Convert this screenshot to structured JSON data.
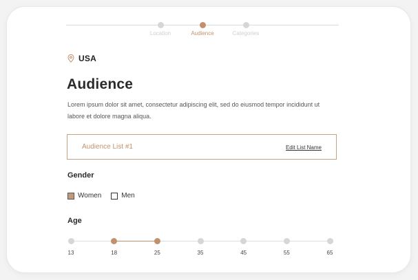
{
  "stepper": {
    "steps": [
      {
        "label": "Location",
        "active": false
      },
      {
        "label": "Audience",
        "active": true
      },
      {
        "label": "Categories",
        "active": false
      }
    ]
  },
  "location": {
    "icon": "map-pin-icon",
    "label": "USA"
  },
  "page": {
    "title": "Audience",
    "description": "Lorem ipsum dolor sit amet, consectetur adipiscing elit, sed do eiusmod tempor incididunt ut labore et dolore magna aliqua."
  },
  "audience_list": {
    "name": "Audience List #1",
    "edit_label": "Edit List Name"
  },
  "gender": {
    "title": "Gender",
    "options": [
      {
        "label": "Women",
        "checked": true
      },
      {
        "label": "Men",
        "checked": false
      }
    ]
  },
  "age": {
    "title": "Age",
    "ticks": [
      "13",
      "18",
      "25",
      "35",
      "45",
      "55",
      "65"
    ],
    "selected_min": "18",
    "selected_max": "25"
  },
  "colors": {
    "accent": "#c0916c",
    "inactive": "#d6d6d6"
  }
}
